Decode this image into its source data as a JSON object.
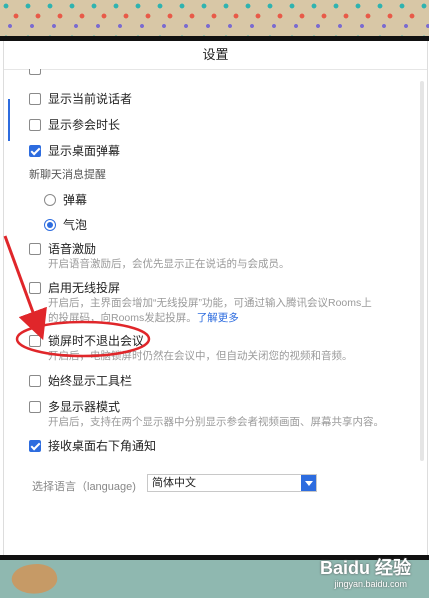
{
  "window": {
    "title": "设置"
  },
  "options": [
    {
      "id": "show-speaker",
      "label": "显示当前说话者",
      "checked": false
    },
    {
      "id": "show-duration",
      "label": "显示参会时长",
      "checked": false
    },
    {
      "id": "show-barrage",
      "label": "显示桌面弹幕",
      "checked": true
    }
  ],
  "chat_reminder": {
    "heading": "新聊天消息提醒",
    "choices": [
      {
        "label": "弹幕",
        "selected": false
      },
      {
        "label": "气泡",
        "selected": true
      }
    ]
  },
  "voice_excite": {
    "label": "语音激励",
    "checked": false,
    "desc": "开启语音激励后，会优先显示正在说话的与会成员。"
  },
  "wireless": {
    "label": "启用无线投屏",
    "checked": false,
    "desc_line1": "开启后，主界面会增加“无线投屏”功能，可通过输入腾讯会议Rooms上",
    "desc_line2": "的投屏码，向Rooms发起投屏。",
    "link": "了解更多"
  },
  "lock_screen": {
    "label": "锁屏时不退出会议",
    "checked": false,
    "desc": "开启后，电脑锁屏时仍然在会议中，但自动关闭您的视频和音频。"
  },
  "toolbar": {
    "label": "始终显示工具栏",
    "checked": false
  },
  "multi_display": {
    "label": "多显示器模式",
    "checked": false,
    "desc": "开启后，支持在两个显示器中分别显示参会者视频画面、屏幕共享内容。"
  },
  "notify": {
    "label": "接收桌面右下角通知",
    "checked": true
  },
  "language": {
    "label": "选择语言（language)",
    "value": "简体中文"
  },
  "watermark": {
    "brand": "Baidu 经验",
    "url": "jingyan.baidu.com"
  },
  "colors": {
    "accent": "#2d6cdf",
    "annotation": "#e0262a"
  }
}
